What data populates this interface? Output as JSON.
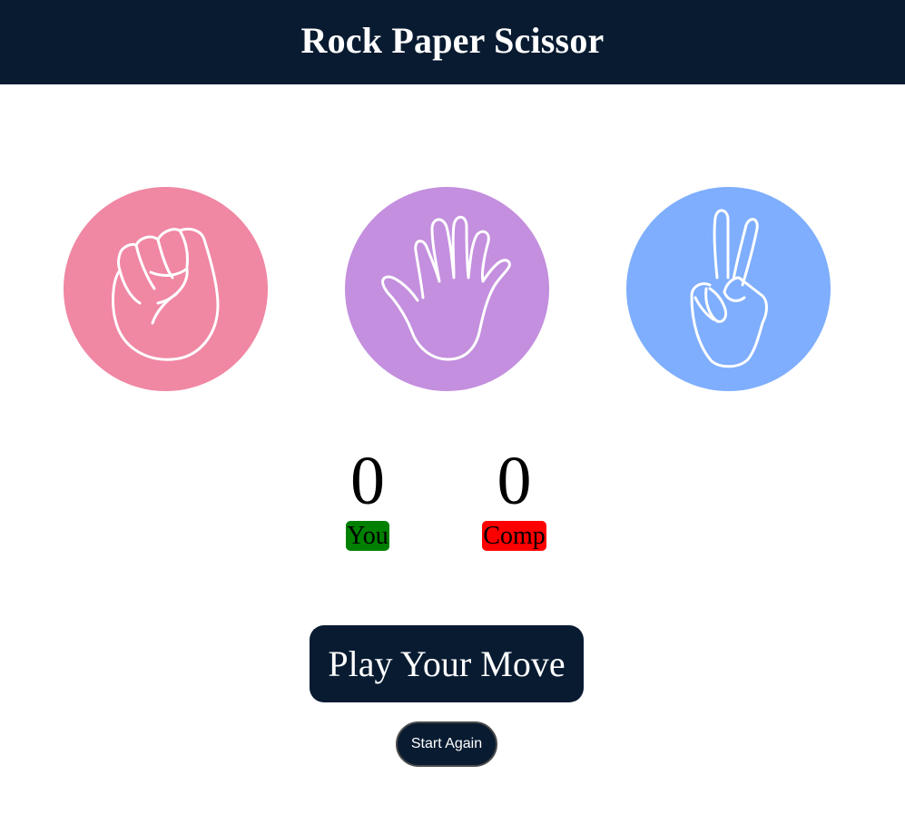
{
  "header": {
    "title": "Rock Paper Scissor"
  },
  "choices": [
    {
      "id": "rock",
      "icon": "fist-icon",
      "color": "#f087a3"
    },
    {
      "id": "paper",
      "icon": "open-hand-icon",
      "color": "#c38fde"
    },
    {
      "id": "scissor",
      "icon": "peace-hand-icon",
      "color": "#7eaefd"
    }
  ],
  "scoreboard": {
    "user": {
      "score": "0",
      "label": "You",
      "color": "#008000"
    },
    "comp": {
      "score": "0",
      "label": "Comp",
      "color": "#ff0000"
    }
  },
  "message": "Play Your Move",
  "reset_label": "Start Again",
  "colors": {
    "primary": "#081b31",
    "background": "#ffffff"
  }
}
